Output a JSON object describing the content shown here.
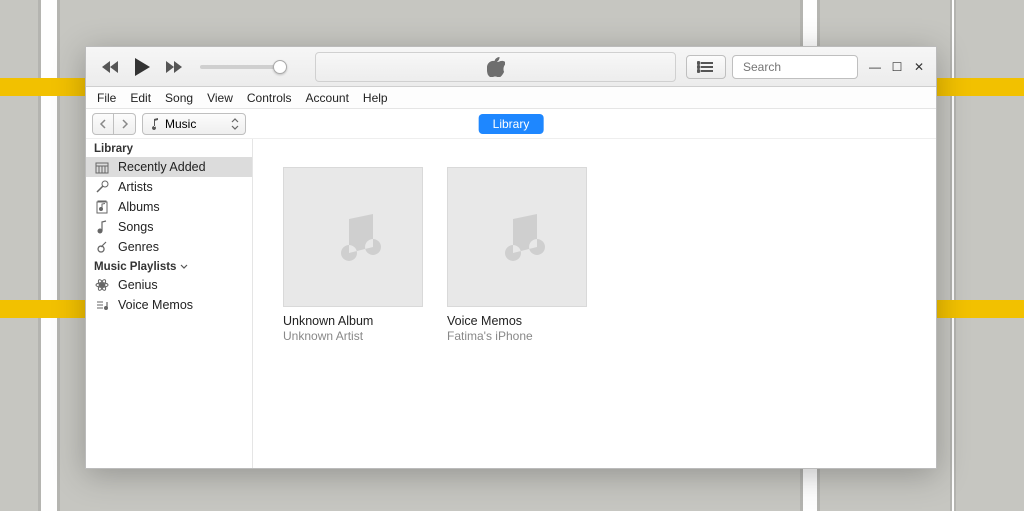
{
  "menubar": [
    "File",
    "Edit",
    "Song",
    "View",
    "Controls",
    "Account",
    "Help"
  ],
  "search": {
    "placeholder": "Search"
  },
  "mediaSelect": {
    "label": "Music"
  },
  "navPill": {
    "label": "Library"
  },
  "sidebar": {
    "heading1": "Library",
    "items1": [
      {
        "label": "Recently Added",
        "selected": true,
        "icon": "calendar"
      },
      {
        "label": "Artists",
        "selected": false,
        "icon": "mic"
      },
      {
        "label": "Albums",
        "selected": false,
        "icon": "album"
      },
      {
        "label": "Songs",
        "selected": false,
        "icon": "note"
      },
      {
        "label": "Genres",
        "selected": false,
        "icon": "guitar"
      }
    ],
    "heading2": "Music Playlists",
    "items2": [
      {
        "label": "Genius",
        "icon": "atom"
      },
      {
        "label": "Voice Memos",
        "icon": "memo"
      }
    ]
  },
  "albums": [
    {
      "title": "Unknown Album",
      "artist": "Unknown Artist"
    },
    {
      "title": "Voice Memos",
      "artist": "Fatima's iPhone"
    }
  ]
}
